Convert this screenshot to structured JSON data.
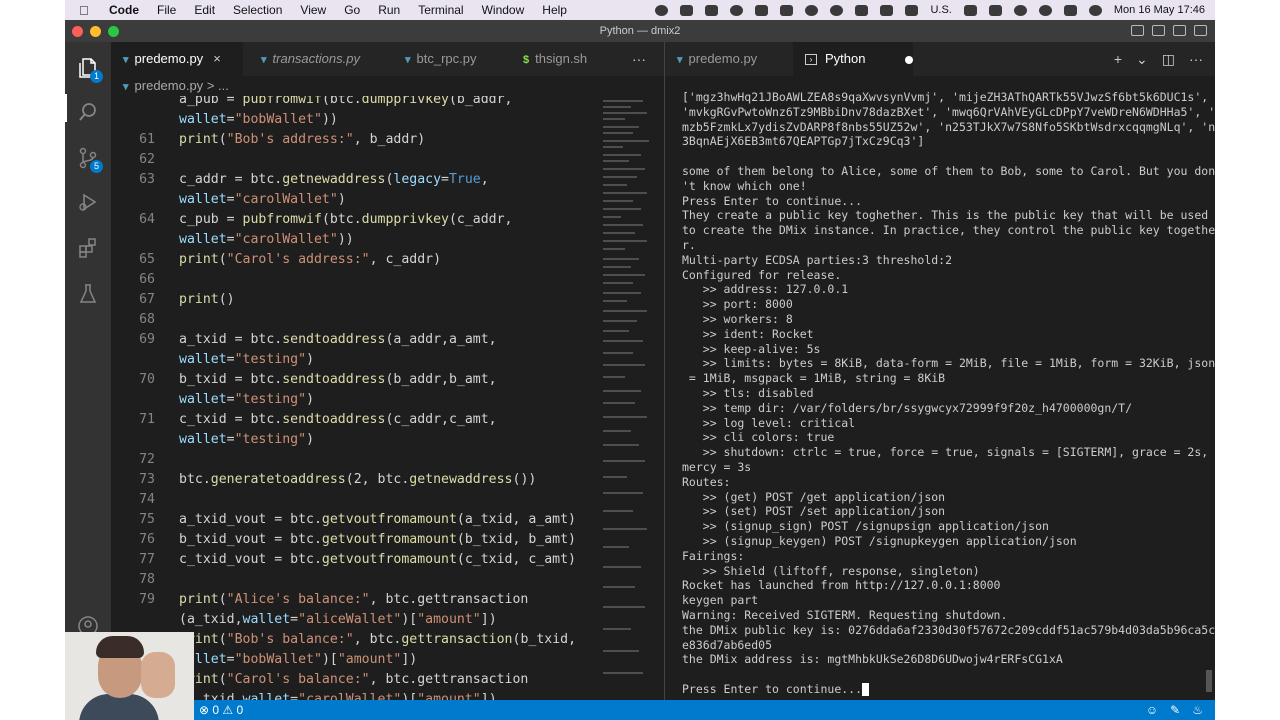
{
  "menubar": {
    "app": "Code",
    "items": [
      "File",
      "Edit",
      "Selection",
      "View",
      "Go",
      "Run",
      "Terminal",
      "Window",
      "Help"
    ],
    "input_source": "U.S.",
    "datetime": "Mon 16 May  17:46"
  },
  "window": {
    "title": "Python — dmix2"
  },
  "activity_bar": {
    "explorer_badge": "1",
    "scm_badge": "5"
  },
  "editor": {
    "tabs": [
      {
        "label": "predemo.py",
        "close": "×"
      },
      {
        "label": "transactions.py"
      },
      {
        "label": "btc_rpc.py"
      },
      {
        "label": "thsign.sh"
      }
    ],
    "more": "···",
    "breadcrumb": {
      "file": "predemo.py",
      "sep": ">",
      "rest": "..."
    },
    "lines": [
      {
        "num": "",
        "text": "a_pub = pubfromwif(btc.dumpprivkey(b_addr,"
      },
      {
        "num": "",
        "text": "wallet=\"bobWallet\"))"
      },
      {
        "num": "61",
        "text": "print(\"Bob's address:\", b_addr)"
      },
      {
        "num": "62",
        "text": ""
      },
      {
        "num": "63",
        "text": "c_addr = btc.getnewaddress(legacy=True,"
      },
      {
        "num": "",
        "text": "wallet=\"carolWallet\")"
      },
      {
        "num": "64",
        "text": "c_pub = pubfromwif(btc.dumpprivkey(c_addr,"
      },
      {
        "num": "",
        "text": "wallet=\"carolWallet\"))"
      },
      {
        "num": "65",
        "text": "print(\"Carol's address:\", c_addr)"
      },
      {
        "num": "66",
        "text": ""
      },
      {
        "num": "67",
        "text": "print()"
      },
      {
        "num": "68",
        "text": ""
      },
      {
        "num": "69",
        "text": "a_txid = btc.sendtoaddress(a_addr,a_amt,"
      },
      {
        "num": "",
        "text": "wallet=\"testing\")"
      },
      {
        "num": "70",
        "text": "b_txid = btc.sendtoaddress(b_addr,b_amt,"
      },
      {
        "num": "",
        "text": "wallet=\"testing\")"
      },
      {
        "num": "71",
        "text": "c_txid = btc.sendtoaddress(c_addr,c_amt,"
      },
      {
        "num": "",
        "text": "wallet=\"testing\")"
      },
      {
        "num": "72",
        "text": ""
      },
      {
        "num": "73",
        "text": "btc.generatetoaddress(2, btc.getnewaddress())"
      },
      {
        "num": "74",
        "text": ""
      },
      {
        "num": "75",
        "text": "a_txid_vout = btc.getvoutfromamount(a_txid, a_amt)"
      },
      {
        "num": "76",
        "text": "b_txid_vout = btc.getvoutfromamount(b_txid, b_amt)"
      },
      {
        "num": "77",
        "text": "c_txid_vout = btc.getvoutfromamount(c_txid, c_amt)"
      },
      {
        "num": "78",
        "text": ""
      },
      {
        "num": "79",
        "text": "print(\"Alice's balance:\", btc.gettransaction"
      },
      {
        "num": "",
        "text": "(a_txid,wallet=\"aliceWallet\")[\"amount\"])"
      },
      {
        "num": "",
        "text": "print(\"Bob's balance:\", btc.gettransaction(b_txid,"
      },
      {
        "num": "",
        "text": "wallet=\"bobWallet\")[\"amount\"])"
      },
      {
        "num": "",
        "text": "print(\"Carol's balance:\", btc.gettransaction"
      },
      {
        "num": "",
        "text": "(c_txid,wallet=\"carolWallet\")[\"amount\"])"
      }
    ]
  },
  "panel": {
    "tabs": [
      {
        "label": "predemo.py"
      },
      {
        "label": "Python"
      }
    ],
    "actions": [
      "+",
      "⌄",
      "◫",
      "···"
    ],
    "terminal_lines": [
      "['mgz3hwHq21JBoAWLZEA8s9qaXwvsynVvmj', 'mijeZH3AThQARTk55VJwzSf6bt5k6DUC1s',",
      "'mvkgRGvPwtoWnz6Tz9MBbiDnv78dazBXet', 'mwq6QrVAhVEyGLcDPpY7veWDreN6WDHHa5', '",
      "mzb5FzmkLx7ydisZvDARP8f8nbs55UZ52w', 'n253TJkX7w7S8Nfo5SKbtWsdrxcqqmgNLq', 'n",
      "3BqnAEjX6EB3mt67QEAPTGp7jTxCz9Cq3']",
      "",
      "some of them belong to Alice, some of them to Bob, some to Carol. But you don",
      "'t know which one!",
      "Press Enter to continue...",
      "They create a public key toghether. This is the public key that will be used",
      "to create the DMix instance. In practice, they control the public key togethe",
      "r.",
      "Multi-party ECDSA parties:3 threshold:2",
      "Configured for release.",
      "   >> address: 127.0.0.1",
      "   >> port: 8000",
      "   >> workers: 8",
      "   >> ident: Rocket",
      "   >> keep-alive: 5s",
      "   >> limits: bytes = 8KiB, data-form = 2MiB, file = 1MiB, form = 32KiB, json",
      " = 1MiB, msgpack = 1MiB, string = 8KiB",
      "   >> tls: disabled",
      "   >> temp dir: /var/folders/br/ssygwcyx72999f9f20z_h4700000gn/T/",
      "   >> log level: critical",
      "   >> cli colors: true",
      "   >> shutdown: ctrlc = true, force = true, signals = [SIGTERM], grace = 2s,",
      "mercy = 3s",
      "Routes:",
      "   >> (get) POST /get application/json",
      "   >> (set) POST /set application/json",
      "   >> (signup_sign) POST /signupsign application/json",
      "   >> (signup_keygen) POST /signupkeygen application/json",
      "Fairings:",
      "   >> Shield (liftoff, response, singleton)",
      "Rocket has launched from http://127.0.0.1:8000",
      "keygen part",
      "Warning: Received SIGTERM. Requesting shutdown.",
      "the DMix public key is: 0276dda6af2330d30f57672c209cddf51ac579b4d03da5b96ca5c",
      "e836d7ab6ed05",
      "the DMix address is: mgtMhbkUkSe26D8D6UDwojw4rERFsCG1xA",
      "",
      "Press Enter to continue..."
    ]
  },
  "statusbar": {
    "problems": "⊗ 0 ⚠ 0"
  },
  "colors": {
    "accent": "#007acc",
    "editor_bg": "#1e1e1e",
    "string": "#ce9178",
    "function": "#dcdcaa",
    "keyword": "#569cd6"
  }
}
